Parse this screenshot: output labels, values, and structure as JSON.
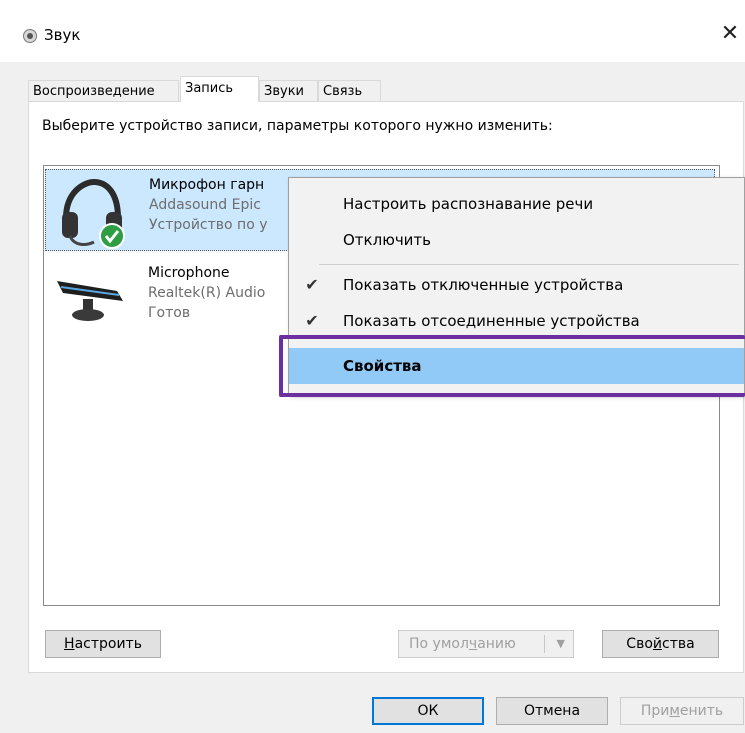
{
  "window": {
    "title": "Звук",
    "close_glyph": "✕"
  },
  "tabs": [
    {
      "label": "Воспроизведение"
    },
    {
      "label": "Запись",
      "active": true
    },
    {
      "label": "Звуки"
    },
    {
      "label": "Связь"
    }
  ],
  "instruction": "Выберите устройство записи, параметры которого нужно изменить:",
  "devices": [
    {
      "name": "Микрофон гарн",
      "line2": "Addasound Epic",
      "line3": "Устройство по у",
      "icon": "headset-icon",
      "status_icon": "check-badge-icon",
      "selected": true
    },
    {
      "name": "Microphone",
      "line2": "Realtek(R) Audio",
      "line3": "Готов",
      "icon": "webcam-microphone-icon",
      "selected": false
    }
  ],
  "context_menu": {
    "items": [
      {
        "label": "Настроить распознавание речи",
        "checked": false
      },
      {
        "label": "Отключить",
        "checked": false
      },
      {
        "label": "Показать отключенные устройства",
        "checked": true
      },
      {
        "label": "Показать отсоединенные устройства",
        "checked": true
      },
      {
        "label": "Свойства",
        "checked": false,
        "highlighted": true
      }
    ],
    "check_glyph": "✔"
  },
  "panel_buttons": {
    "configure": {
      "pre": "",
      "mnemonic": "Н",
      "post": "астроить"
    },
    "default": {
      "pre": "По умол",
      "mnemonic": "ч",
      "post": "анию"
    },
    "properties": {
      "pre": "Сво",
      "mnemonic": "й",
      "post": "ства"
    }
  },
  "dialog_buttons": {
    "ok": "ОК",
    "cancel": "Отмена",
    "apply": {
      "pre": "При",
      "mnemonic": "м",
      "post": "енить"
    }
  },
  "colors": {
    "selection": "#cce8ff",
    "menu_highlight": "#91c9f7",
    "annotation": "#6b2fa0",
    "accent": "#0078d7",
    "check_green": "#2e9e44"
  }
}
